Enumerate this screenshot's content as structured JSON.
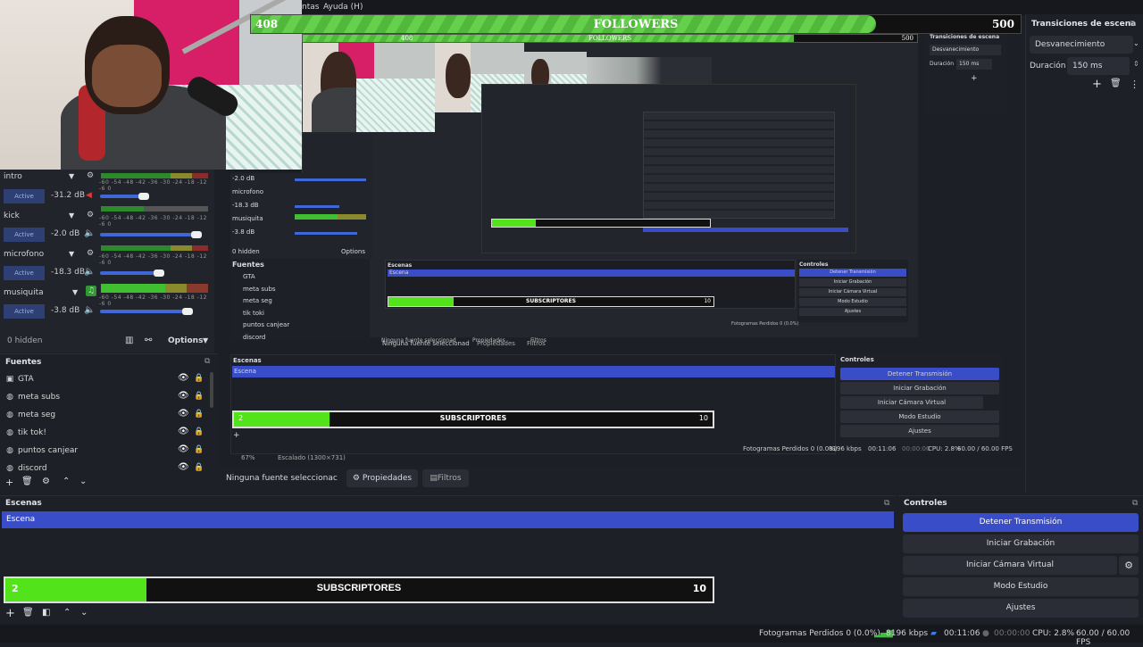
{
  "menu": {
    "partial": "ntas",
    "help": "Ayuda (H)"
  },
  "followers": {
    "left": "408",
    "title": "FOLLOWERS",
    "right": "500",
    "nested_left": "408",
    "nested_right": "500",
    "nested_title": "FOLLOWERS"
  },
  "mixer": {
    "tracks": [
      {
        "name": "intro",
        "db": "-31.2 dB",
        "active": "Active"
      },
      {
        "name": "kick",
        "db": "-2.0 dB",
        "active": "Active"
      },
      {
        "name": "microfono",
        "db": "-18.3 dB",
        "active": "Active"
      },
      {
        "name": "musiquita",
        "db": "-3.8 dB",
        "active": "Active"
      }
    ],
    "scale": "-60 -54 -48 -42 -36 -30 -24 -18 -12 -6 0",
    "hidden": "0 hidden",
    "options": "Options"
  },
  "sources": {
    "title": "Fuentes",
    "items": [
      "GTA",
      "meta subs",
      "meta seg",
      "tik tok!",
      "puntos canjear",
      "discord"
    ]
  },
  "mid": {
    "sources_title": "Fuentes",
    "sources": [
      "GTA",
      "meta subs",
      "meta seg",
      "tik toki",
      "puntos canjear",
      "discord"
    ],
    "hidden": "0 hidden",
    "options": "Options",
    "tracks": [
      {
        "db": "-2.0 dB",
        "name": "microfono"
      },
      {
        "db": "-18.3 dB",
        "name": "musiquita"
      },
      {
        "db": "-3.8 dB",
        "name": ""
      }
    ],
    "no_source": "Ninguna fuente seleccionad",
    "props": "Propiedades",
    "filters": "Filtros",
    "scenes_title": "Escenas",
    "scene": "Escena",
    "controls_title": "Controles",
    "buttons": [
      "Detener Transmisión",
      "Iniciar Grabación",
      "Iniciar Cámara Virtual",
      "Modo Estudio",
      "Ajustes"
    ],
    "zoom": "67%",
    "scale_mode": "Escalado (1300×731)",
    "status": "Fotogramas Perdidos 0 (0.0%)",
    "kbps": "8196 kbps",
    "time": "00:11:06",
    "rec": "00:00:00",
    "cpu": "CPU: 2.8%",
    "fps": "60.00 / 60.00 FPS",
    "subs_num": "2",
    "subs_label": "SUBSCRIPTORES",
    "subs_goal": "10"
  },
  "transitions": {
    "title": "Transiciones de escena",
    "selected": "Desvanecimiento",
    "duration_label": "Duración",
    "duration": "150 ms"
  },
  "nested_transitions": {
    "title": "Transiciones de escena",
    "selected": "Desvanecimiento",
    "duration_label": "Duración",
    "duration": "150 ms"
  },
  "props_bar": {
    "no_source": "Ninguna fuente seleccionac",
    "props": "Propiedades",
    "filters": "Filtros"
  },
  "scenes": {
    "title": "Escenas",
    "items": [
      "Escena"
    ]
  },
  "subs": {
    "num": "2",
    "label": "SUBSCRIPTORES",
    "goal": "10",
    "fraction": 0.2
  },
  "controls": {
    "title": "Controles",
    "buttons": [
      "Detener Transmisión",
      "Iniciar Grabación",
      "Iniciar Cámara Virtual",
      "Modo Estudio",
      "Ajustes"
    ]
  },
  "status": {
    "dropped": "Fotogramas Perdidos 0 (0.0%)",
    "kbps": "8196 kbps",
    "live": "00:11:06",
    "rec": "00:00:00",
    "cpu": "CPU: 2.8%",
    "fps": "60.00 / 60.00 FPS"
  },
  "colors": {
    "accent": "#3a4dc8",
    "green": "#52e31a",
    "pink": "#d71f68"
  }
}
